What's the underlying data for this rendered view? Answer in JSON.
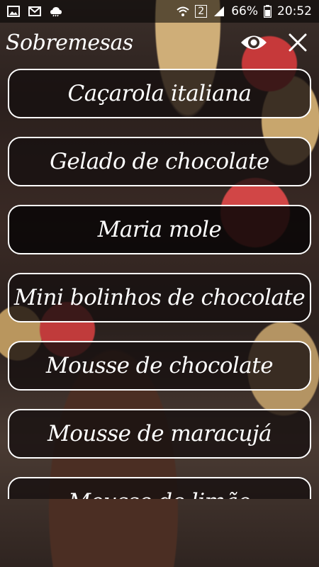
{
  "status_bar": {
    "left_icons": [
      "gallery-icon",
      "gmail-icon",
      "cloud-icon"
    ],
    "sim_label": "2",
    "battery": "66%",
    "time": "20:52"
  },
  "header": {
    "title": "Sobremesas",
    "eye_icon": "eye-icon",
    "close_icon": "close-icon"
  },
  "items": [
    {
      "label": "Caçarola italiana"
    },
    {
      "label": "Gelado de chocolate"
    },
    {
      "label": "Maria mole"
    },
    {
      "label": "Mini bolinhos de chocolate"
    },
    {
      "label": "Mousse de chocolate"
    },
    {
      "label": "Mousse de maracujá"
    },
    {
      "label": "Mousse de limão"
    }
  ]
}
